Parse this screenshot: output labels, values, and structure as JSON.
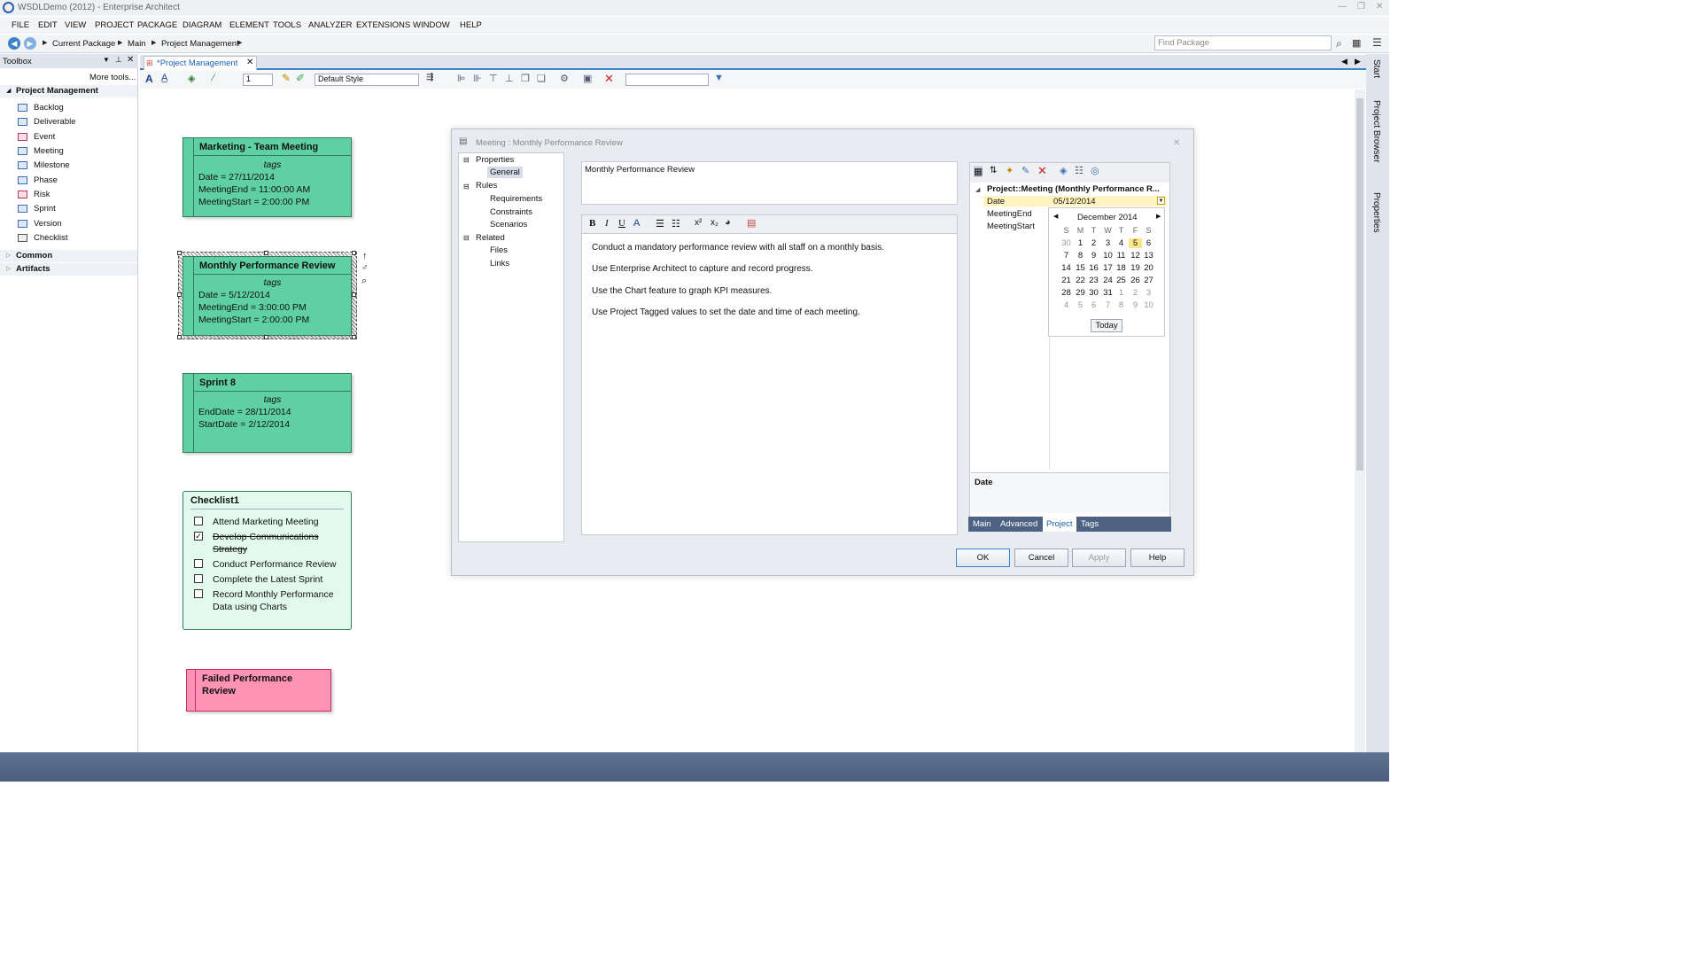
{
  "window": {
    "title": "WSDLDemo (2012) - Enterprise Architect"
  },
  "menu": [
    "FILE",
    "EDIT",
    "VIEW",
    "PROJECT",
    "PACKAGE",
    "DIAGRAM",
    "ELEMENT",
    "TOOLS",
    "ANALYZER",
    "EXTENSIONS",
    "WINDOW",
    "HELP"
  ],
  "breadcrumb": [
    "Current Package",
    "Main",
    "Project Management"
  ],
  "find_package_placeholder": "Find Package",
  "toolbox": {
    "title": "Toolbox",
    "more_tools": "More tools...",
    "group": "Project Management",
    "items": [
      "Backlog",
      "Deliverable",
      "Event",
      "Meeting",
      "Milestone",
      "Phase",
      "Risk",
      "Sprint",
      "Version",
      "Checklist"
    ],
    "other_groups": [
      "Common",
      "Artifacts"
    ]
  },
  "doc_tab": "*Project Management",
  "diagram_toolbar": {
    "line_width": "1",
    "style": "Default Style"
  },
  "elements": {
    "marketing": {
      "title": "Marketing - Team Meeting",
      "tags": "tags",
      "lines": [
        "Date = 27/11/2014",
        "MeetingEnd = 11:00:00 AM",
        "MeetingStart = 2:00:00 PM"
      ]
    },
    "monthly": {
      "title": "Monthly Performance Review",
      "tags": "tags",
      "lines": [
        "Date = 5/12/2014",
        "MeetingEnd = 3:00:00 PM",
        "MeetingStart = 2:00:00 PM"
      ]
    },
    "sprint": {
      "title": "Sprint 8",
      "tags": "tags",
      "lines": [
        "EndDate = 28/11/2014",
        "StartDate = 2/12/2014"
      ]
    },
    "checklist": {
      "title": "Checklist1",
      "items": [
        {
          "label": "Attend Marketing Meeting",
          "checked": false
        },
        {
          "label": "Develop Communications",
          "label2": "Strategy",
          "checked": true
        },
        {
          "label": "Conduct Performance Review",
          "checked": false
        },
        {
          "label": "Complete the Latest Sprint",
          "checked": false
        },
        {
          "label": "Record Monthly Performance",
          "label2": "Data using Charts",
          "checked": false
        }
      ]
    },
    "failed": {
      "line1": "Failed Performance",
      "line2": "Review"
    }
  },
  "dialog": {
    "title": "Meeting : Monthly Performance Review",
    "tree": {
      "properties": "Properties",
      "general": "General",
      "rules": "Rules",
      "requirements": "Requirements",
      "constraints": "Constraints",
      "scenarios": "Scenarios",
      "related": "Related",
      "files": "Files",
      "links": "Links"
    },
    "name": "Monthly Performance Review",
    "notes": [
      "Conduct a mandatory performance review with all staff on a monthly basis.",
      "Use Enterprise Architect to capture and record progress.",
      "Use the Chart feature to graph KPI measures.",
      "Use Project Tagged values to set the date and time of each meeting."
    ],
    "props": {
      "header": "Project::Meeting (Monthly Performance R...",
      "rows": [
        {
          "name": "Date",
          "value": "05/12/2014"
        },
        {
          "name": "MeetingEnd",
          "value": ""
        },
        {
          "name": "MeetingStart",
          "value": ""
        }
      ],
      "description_label": "Date",
      "tabs": [
        "Main",
        "Advanced",
        "Project",
        "Tags"
      ],
      "active_tab": "Project"
    },
    "calendar": {
      "month": "December 2014",
      "weekdays": [
        "S",
        "M",
        "T",
        "W",
        "T",
        "F",
        "S"
      ],
      "weeks": [
        [
          "30",
          "1",
          "2",
          "3",
          "4",
          "5",
          "6"
        ],
        [
          "7",
          "8",
          "9",
          "10",
          "11",
          "12",
          "13"
        ],
        [
          "14",
          "15",
          "16",
          "17",
          "18",
          "19",
          "20"
        ],
        [
          "21",
          "22",
          "23",
          "24",
          "25",
          "26",
          "27"
        ],
        [
          "28",
          "29",
          "30",
          "31",
          "1",
          "2",
          "3"
        ],
        [
          "4",
          "5",
          "6",
          "7",
          "8",
          "9",
          "10"
        ]
      ],
      "selected": "5",
      "today_label": "Today"
    },
    "buttons": {
      "ok": "OK",
      "cancel": "Cancel",
      "apply": "Apply",
      "help": "Help"
    }
  },
  "right_dock": [
    "Start",
    "Project Browser",
    "Properties"
  ],
  "colors": {
    "element_green": "#5fd0a2",
    "failed_pink": "#ff93b5",
    "accent_blue": "#3b82c8"
  }
}
